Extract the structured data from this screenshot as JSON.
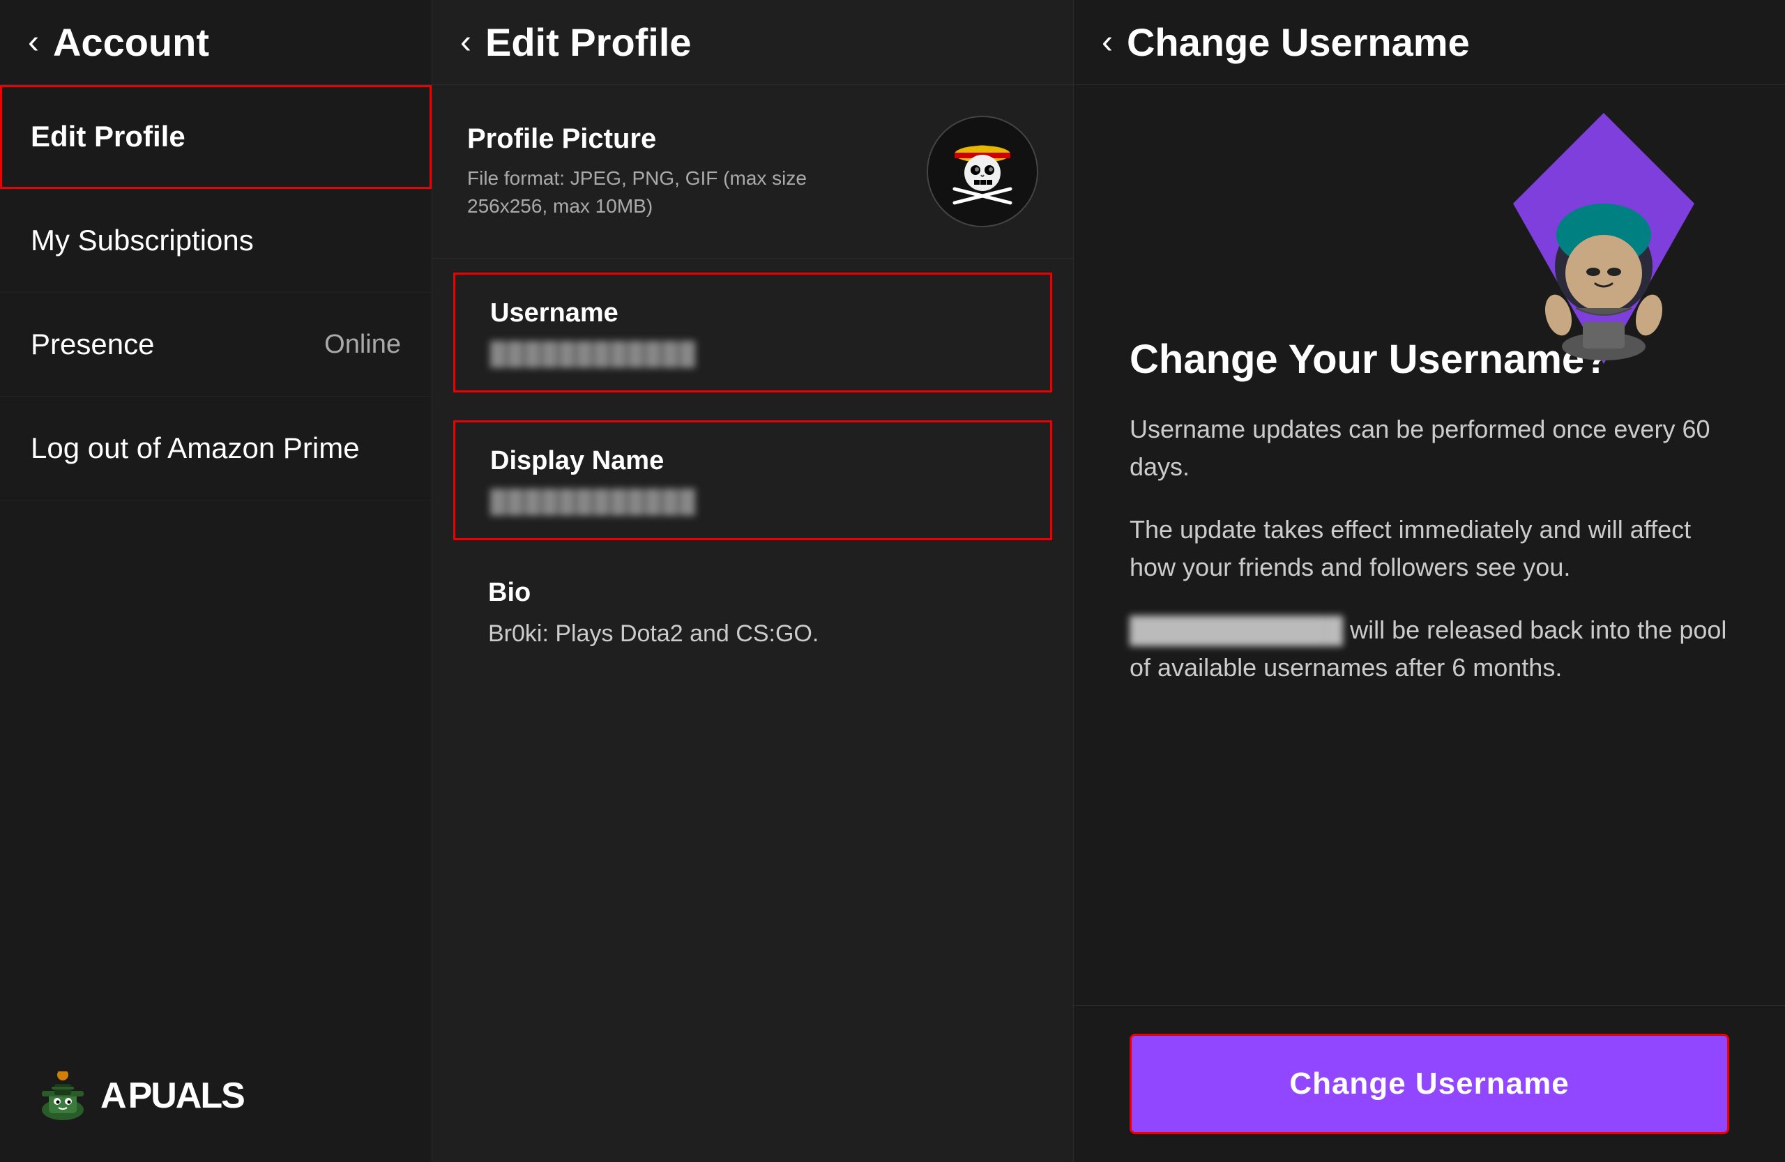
{
  "left_panel": {
    "header": {
      "back_label": "‹",
      "title": "Account"
    },
    "nav_items": [
      {
        "id": "edit-profile",
        "label": "Edit Profile",
        "status": "",
        "active": true
      },
      {
        "id": "my-subscriptions",
        "label": "My Subscriptions",
        "status": "",
        "active": false
      },
      {
        "id": "presence",
        "label": "Presence",
        "status": "Online",
        "active": false
      },
      {
        "id": "log-out-amazon",
        "label": "Log out of Amazon Prime",
        "status": "",
        "active": false
      }
    ]
  },
  "middle_panel": {
    "header": {
      "back_label": "‹",
      "title": "Edit Profile"
    },
    "profile_picture": {
      "label": "Profile Picture",
      "description": "File format: JPEG, PNG, GIF (max size 256x256, max 10MB)"
    },
    "username": {
      "label": "Username",
      "value": "████████████"
    },
    "display_name": {
      "label": "Display Name",
      "value": "████████████"
    },
    "bio": {
      "label": "Bio",
      "value": "Br0ki: Plays Dota2 and CS:GO."
    }
  },
  "right_panel": {
    "header": {
      "back_label": "‹",
      "title": "Change Username"
    },
    "heading": "Change Your Username?",
    "body_line1": "Username updates can be performed once every 60 days.",
    "body_line2": "The update takes effect immediately and will affect how your friends and followers see you.",
    "body_line3_prefix": "████████████",
    "body_line3_suffix": " will be released back into the pool of available usernames after 6 months.",
    "button_label": "Change Username"
  },
  "watermark": {
    "text": "PUALS"
  }
}
